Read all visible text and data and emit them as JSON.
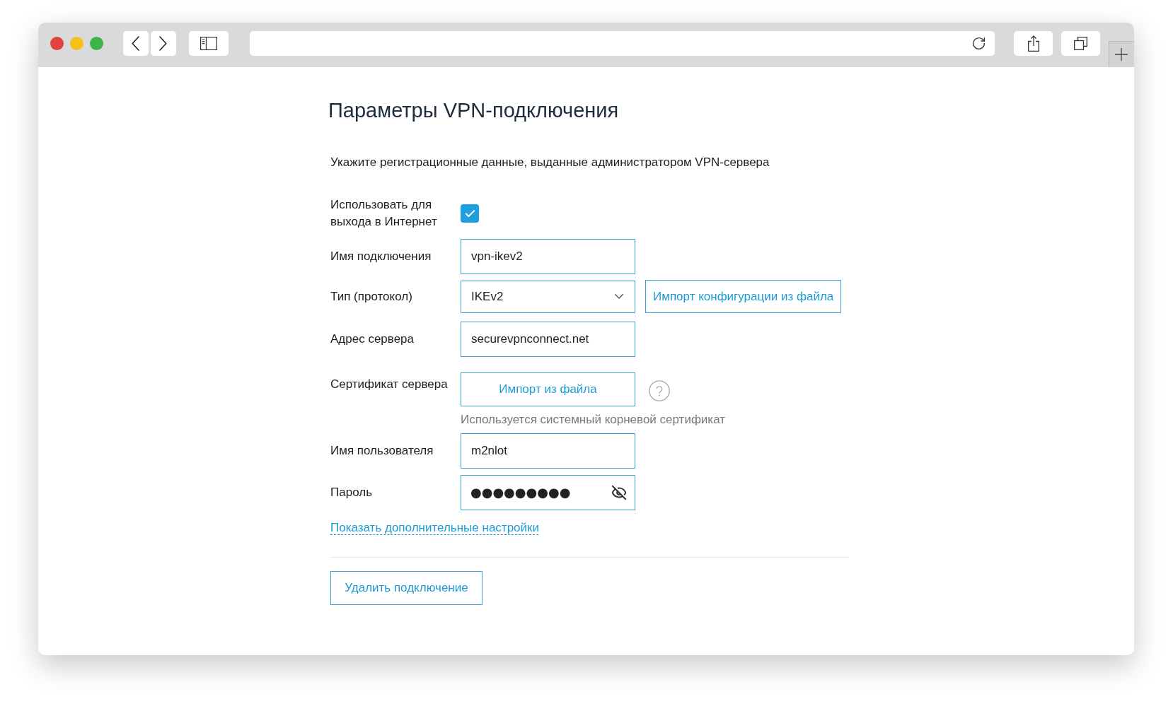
{
  "page": {
    "title": "Параметры VPN-подключения",
    "description": "Укажите регистрационные данные, выданные администратором VPN-сервера"
  },
  "form": {
    "rows": [
      {
        "kind": "checkbox",
        "label": "Использовать для выхода в Интернет",
        "checked": true
      },
      {
        "kind": "text",
        "label": "Имя подключения",
        "value": "vpn-ikev2"
      },
      {
        "kind": "select",
        "label": "Тип (протокол)",
        "value": "IKEv2",
        "button": "Импорт конфигурации из файла"
      },
      {
        "kind": "text",
        "label": "Адрес сервера",
        "value": "securevpnconnect.net"
      },
      {
        "kind": "file",
        "label": "Сертификат сервера",
        "button": "Импорт из файла",
        "hint": "Используется системный корневой сертификат"
      },
      {
        "kind": "text",
        "label": "Имя пользователя",
        "value": "m2nlot"
      },
      {
        "kind": "password",
        "label": "Пароль",
        "value": "●●●●●●●●●"
      }
    ],
    "advanced_link": "Показать дополнительные настройки",
    "delete_button": "Удалить подключение"
  }
}
